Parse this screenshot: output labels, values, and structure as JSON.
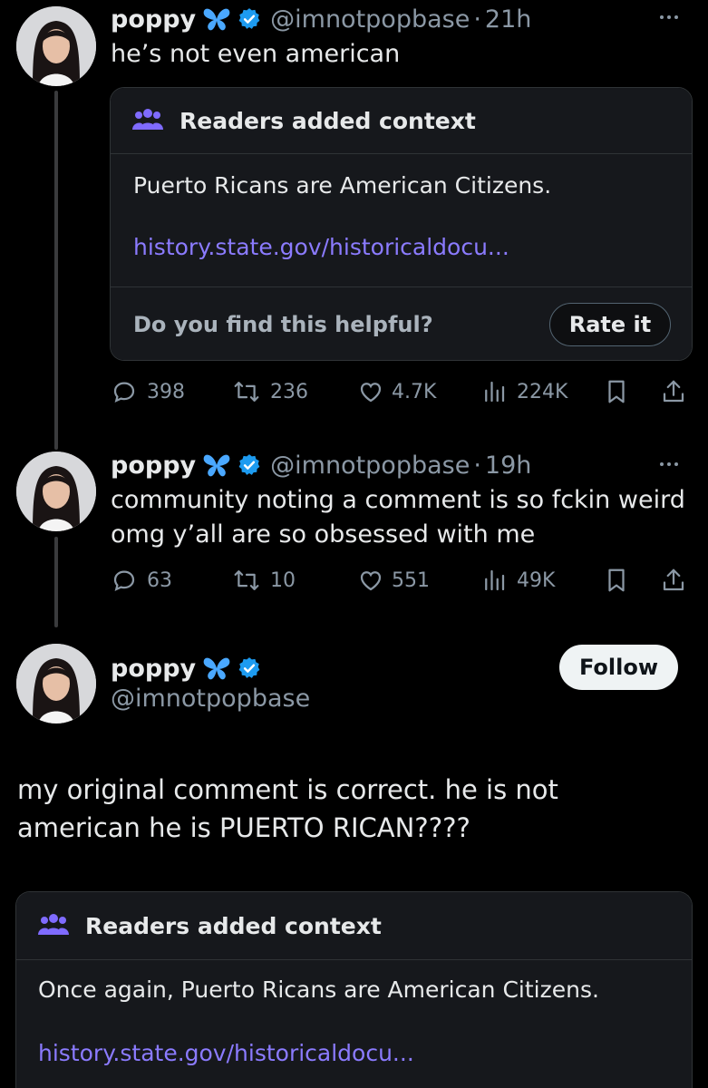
{
  "tweets": [
    {
      "name": "poppy",
      "handle": "@imnotpopbase",
      "dot": "·",
      "time": "21h",
      "text": "he’s not even american",
      "note": {
        "title": "Readers added context",
        "text": "Puerto Ricans are American Citizens.",
        "link": "history.state.gov/historicaldocu...",
        "helpful_prompt": "Do you find this helpful?",
        "rate_label": "Rate it"
      },
      "stats": {
        "replies": "398",
        "reposts": "236",
        "likes": "4.7K",
        "views": "224K"
      }
    },
    {
      "name": "poppy",
      "handle": "@imnotpopbase",
      "dot": "·",
      "time": "19h",
      "text_line1": "community noting a comment is so fckin weird",
      "text_line2": "omg y’all are so obsessed with me",
      "stats": {
        "replies": "63",
        "reposts": "10",
        "likes": "551",
        "views": "49K"
      }
    }
  ],
  "main": {
    "name": "poppy",
    "handle": "@imnotpopbase",
    "follow_label": "Follow",
    "text_line1": "my original comment is correct. he is not",
    "text_line2": "american he is PUERTO RICAN????",
    "note": {
      "title": "Readers added context",
      "text": "Once again, Puerto Ricans are American Citizens.",
      "link": "history.state.gov/historicaldocu..."
    }
  },
  "colors": {
    "background": "#000000",
    "link": "#8b7bff",
    "verified": "#1d9bf0",
    "butterfly": "#4aa8ff",
    "muted": "#8b98a5",
    "note_icon": "#7f6bff"
  },
  "icons": [
    "butterfly-icon",
    "verified-icon",
    "more-icon",
    "people-icon",
    "reply-icon",
    "repost-icon",
    "like-icon",
    "views-icon",
    "bookmark-icon",
    "share-icon"
  ]
}
